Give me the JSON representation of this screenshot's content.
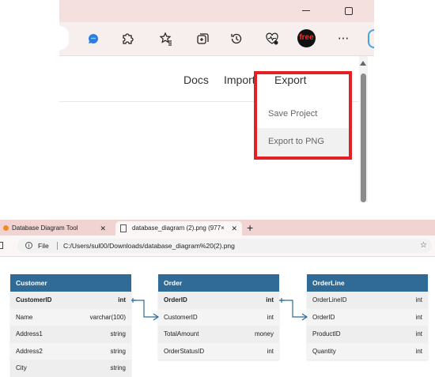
{
  "top_screenshot": {
    "toolbar_icons": [
      "copilot-icon",
      "extensions-icon",
      "favorites-icon",
      "collections-icon",
      "history-icon",
      "performance-icon",
      "free-badge-icon",
      "more-icon"
    ],
    "free_badge": "free",
    "nav": {
      "docs": "Docs",
      "import": "Import",
      "export": "Export"
    },
    "menu": {
      "save_project": "Save Project",
      "export_png": "Export to PNG"
    }
  },
  "bottom_screenshot": {
    "tabs": [
      {
        "label": "Database Diagram Tool"
      },
      {
        "label": "database_diagram (2).png (977×"
      }
    ],
    "new_tab": "+",
    "address": {
      "file_label": "File",
      "path": "C:/Users/sul00/Downloads/database_diagram%20(2).png"
    },
    "tables": [
      {
        "name": "Customer",
        "rows": [
          {
            "col": "CustomerID",
            "type": "int",
            "pk": true
          },
          {
            "col": "Name",
            "type": "varchar(100)"
          },
          {
            "col": "Address1",
            "type": "string"
          },
          {
            "col": "Address2",
            "type": "string"
          },
          {
            "col": "City",
            "type": "string"
          }
        ]
      },
      {
        "name": "Order",
        "rows": [
          {
            "col": "OrderID",
            "type": "int",
            "pk": true
          },
          {
            "col": "CustomerID",
            "type": "int"
          },
          {
            "col": "TotalAmount",
            "type": "money"
          },
          {
            "col": "OrderStatusID",
            "type": "int"
          }
        ]
      },
      {
        "name": "OrderLine",
        "rows": [
          {
            "col": "OrderLineID",
            "type": "int"
          },
          {
            "col": "OrderID",
            "type": "int"
          },
          {
            "col": "ProductID",
            "type": "int"
          },
          {
            "col": "Quantity",
            "type": "int"
          }
        ]
      }
    ],
    "colors": {
      "table_header": "#2f6b96",
      "connector": "#2f6b96",
      "highlight_box": "#e02227"
    }
  }
}
